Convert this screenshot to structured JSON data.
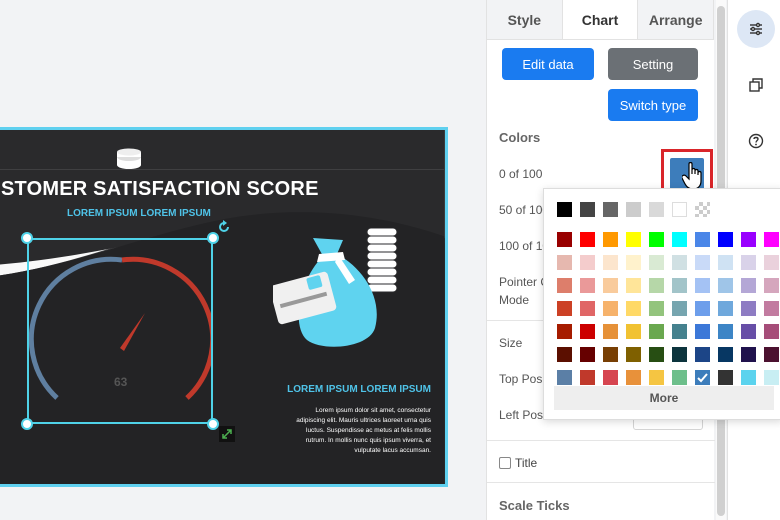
{
  "slide": {
    "title": "STOMER SATISFACTION SCORE",
    "subtitle": "LOREM IPSUM LOREM IPSUM",
    "gauge_value": "63",
    "text_title": "LOREM IPSUM LOREM IPSUM",
    "text_body": "Lorem ipsum dolor sit amet, consectetur adipiscing elit. Mauris ultrices laoreet urna quis luctus. Suspendisse ac metus at felis mollis rutrum. In mollis nunc quis ipsum viverra, et vulputate lacus accumsan."
  },
  "panel": {
    "tabs": [
      "Style",
      "Chart",
      "Arrange"
    ],
    "active_tab": "Chart",
    "edit_data": "Edit data",
    "setting": "Setting",
    "switch_type": "Switch type",
    "colors_heading": "Colors",
    "color_ranges": [
      "0 of 100",
      "50 of 100",
      "100 of 100"
    ],
    "pointer_label": "Pointer C",
    "mode_label": "Mode",
    "size_label": "Size",
    "top_label": "Top Posi",
    "left_label": "Left Posi",
    "title_checkbox": "Title",
    "scale_ticks": "Scale Ticks",
    "selected_color": "#3d7dbb"
  },
  "rail": {
    "icons": [
      "sliders-icon",
      "copy-icon",
      "help-icon"
    ]
  },
  "picker": {
    "rows": [
      [
        "#000000",
        "#444444",
        "#666666",
        "#cccccc",
        "#d9d9d9",
        "#ffffff",
        "transparent"
      ],
      [
        "#990000",
        "#ff0000",
        "#ff9900",
        "#ffff00",
        "#00ff00",
        "#00ffff",
        "#4a86e8",
        "#0000ff",
        "#9900ff",
        "#ff00ff"
      ],
      [
        "#e6b8af",
        "#f4cccc",
        "#fce5cd",
        "#fff2cc",
        "#d9ead3",
        "#d0e0e3",
        "#c9daf8",
        "#cfe2f3",
        "#d9d2e9",
        "#ead1dc"
      ],
      [
        "#dd7e6b",
        "#ea9999",
        "#f9cb9c",
        "#ffe599",
        "#b6d7a8",
        "#a2c4c9",
        "#a4c2f4",
        "#9fc5e8",
        "#b4a7d6",
        "#d5a6bd"
      ],
      [
        "#cc4125",
        "#e06666",
        "#f6b26b",
        "#ffd966",
        "#93c47d",
        "#76a5af",
        "#6d9eeb",
        "#6fa8dc",
        "#8e7cc3",
        "#c27ba0"
      ],
      [
        "#a61c00",
        "#cc0000",
        "#e69138",
        "#f1c232",
        "#6aa84f",
        "#45818e",
        "#3c78d8",
        "#3d85c6",
        "#674ea7",
        "#a64d79"
      ],
      [
        "#5b0f00",
        "#660000",
        "#783f04",
        "#7f6000",
        "#274e13",
        "#0c343d",
        "#1c4587",
        "#073763",
        "#20124d",
        "#4c1130"
      ],
      [
        "#5b7fa6",
        "#c0392b",
        "#d64550",
        "#e8913a",
        "#f5c542",
        "#6dbf8b",
        "#3d7dbb",
        "#333333",
        "#5bd3ee",
        "#c8eef3"
      ]
    ],
    "more": "More"
  }
}
